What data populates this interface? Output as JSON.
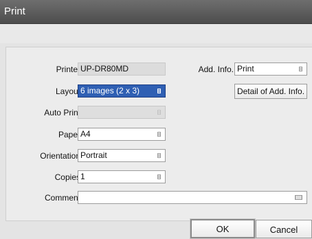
{
  "window": {
    "title": "Print"
  },
  "form": {
    "printer": {
      "label": "Printer",
      "value": "UP-DR80MD"
    },
    "layout": {
      "label": "Layout",
      "value": "6 images (2 x 3)"
    },
    "auto_print": {
      "label": "Auto Print",
      "value": ""
    },
    "paper": {
      "label": "Paper",
      "value": "A4"
    },
    "orientation": {
      "label": "Orientation",
      "value": "Portrait"
    },
    "copies": {
      "label": "Copies",
      "value": "1"
    },
    "comment": {
      "label": "Comment",
      "value": ""
    },
    "add_info": {
      "label": "Add. Info.",
      "value": "Print"
    },
    "detail_button": "Detail of Add. Info."
  },
  "buttons": {
    "ok": "OK",
    "cancel": "Cancel"
  },
  "icons": {
    "dropdown": "dropdown-icon",
    "keyboard": "keyboard-icon"
  },
  "colors": {
    "titlebar": "#555555",
    "selected": "#2f5fb3",
    "panel": "#ececec"
  }
}
